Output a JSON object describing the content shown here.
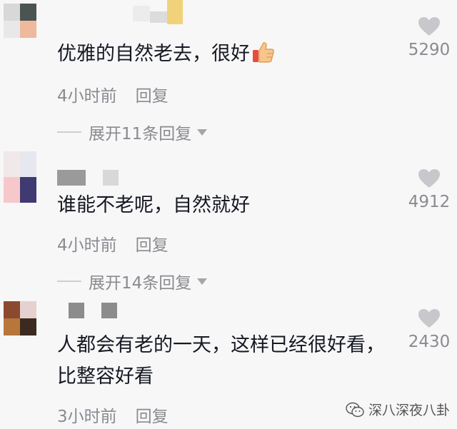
{
  "comments": [
    {
      "text": "优雅的自然老去，很好",
      "time": "4小时前",
      "reply_label": "回复",
      "expand_label": "展开11条回复",
      "likes": "5290",
      "has_thumbs_up": true,
      "avatar_colors": [
        "#d8d8d8",
        "#4a5450",
        "#e8e8e8",
        "#eeb99c"
      ],
      "username_colors": [
        "#ececec",
        "#dcdcdc",
        "#f1d27a"
      ]
    },
    {
      "text": "谁能不老呢，自然就好",
      "time": "4小时前",
      "reply_label": "回复",
      "expand_label": "展开14条回复",
      "likes": "4912",
      "has_thumbs_up": false,
      "avatar_colors": [
        "#f1e8ea",
        "#e7e8ef",
        "#f6c8cc",
        "#3f3a72"
      ],
      "username_colors": [
        "#9a9a9a",
        "#d8d8d8"
      ]
    },
    {
      "text": "人都会有老的一天，这样已经很好看，比整容好看",
      "time": "3小时前",
      "reply_label": "回复",
      "likes": "2430",
      "has_thumbs_up": false,
      "avatar_colors": [
        "#8b4a2f",
        "#e5d1cf",
        "#b9763c",
        "#3a2a20"
      ],
      "username_colors": [
        "#8c8c8c",
        "#8c8c8c"
      ]
    }
  ],
  "watermark": {
    "text": "深八深夜八卦",
    "icon": "wechat-icon"
  },
  "colors": {
    "background": "#f7f7f7",
    "text": "#161823",
    "secondary_text": "#8a8b91",
    "heart": "#c8c8cc"
  }
}
